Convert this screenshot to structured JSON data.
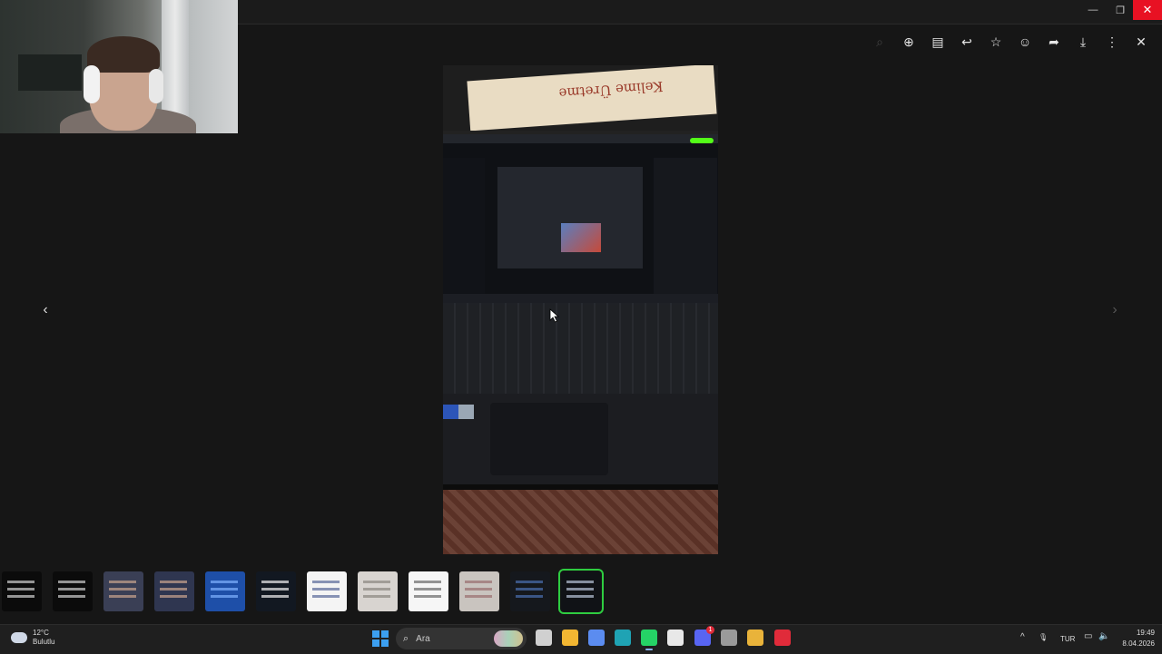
{
  "window": {
    "minimize": "—",
    "maximize": "❐",
    "close": "✕"
  },
  "viewer": {
    "toolbar": [
      {
        "name": "zoom-out-icon",
        "glyph": "⌕",
        "dim": true
      },
      {
        "name": "zoom-in-icon",
        "glyph": "⊕"
      },
      {
        "name": "caption-icon",
        "glyph": "▤"
      },
      {
        "name": "reply-icon",
        "glyph": "↩"
      },
      {
        "name": "star-icon",
        "glyph": "☆"
      },
      {
        "name": "emoji-icon",
        "glyph": "☺"
      },
      {
        "name": "forward-icon",
        "glyph": "➦"
      },
      {
        "name": "download-icon",
        "glyph": "⤓"
      },
      {
        "name": "more-icon",
        "glyph": "⋮"
      },
      {
        "name": "close-viewer-icon",
        "glyph": "✕"
      }
    ],
    "prev": "‹",
    "next": "›",
    "photo_text": "Kelime Üretme"
  },
  "thumbnails": [
    {
      "name": "thumb-1",
      "bg": "#0b0b0b",
      "fg": "#cfcfcf"
    },
    {
      "name": "thumb-2",
      "bg": "#0b0b0b",
      "fg": "#cfcfcf"
    },
    {
      "name": "thumb-3",
      "bg": "#3a3f55",
      "fg": "#c9a48f"
    },
    {
      "name": "thumb-4",
      "bg": "#2f3650",
      "fg": "#c9a48f"
    },
    {
      "name": "thumb-5",
      "bg": "#1e4fa8",
      "fg": "#7fb2ff"
    },
    {
      "name": "thumb-6",
      "bg": "#121821",
      "fg": "#f0f0f0"
    },
    {
      "name": "thumb-7",
      "bg": "#f4f4f4",
      "fg": "#5a6a9a"
    },
    {
      "name": "thumb-8",
      "bg": "#d8d4d0",
      "fg": "#8a8680"
    },
    {
      "name": "thumb-9",
      "bg": "#f6f6f6",
      "fg": "#6a6a6a"
    },
    {
      "name": "thumb-10",
      "bg": "#c9c4bf",
      "fg": "#9a6e6e"
    },
    {
      "name": "thumb-11",
      "bg": "#15181d",
      "fg": "#4a6fb0"
    },
    {
      "name": "thumb-12",
      "bg": "#101216",
      "fg": "#b8c4d8",
      "selected": true
    }
  ],
  "taskbar": {
    "weather_temp": "12°C",
    "weather_text": "Bulutlu",
    "search_placeholder": "Ara",
    "apps": [
      {
        "name": "task-view-icon",
        "color": "#d0d0d0"
      },
      {
        "name": "file-explorer-icon",
        "color": "#f2b632"
      },
      {
        "name": "copilot-icon",
        "color": "#5b8cf0"
      },
      {
        "name": "edge-icon",
        "color": "#1fa3b4"
      },
      {
        "name": "whatsapp-icon",
        "color": "#25d366",
        "active": true
      },
      {
        "name": "store-icon",
        "color": "#e8e8e8"
      },
      {
        "name": "discord-icon",
        "color": "#5865f2",
        "badge": "1"
      },
      {
        "name": "steam-icon",
        "color": "#9a9a9a"
      },
      {
        "name": "chrome-icon",
        "color": "#e9b33a"
      },
      {
        "name": "app-red-icon",
        "color": "#e02b3a"
      }
    ],
    "tray_chevron": "^",
    "mic": "🎙",
    "language": "TUR",
    "time": "19:49",
    "date": "8.04.2026"
  }
}
